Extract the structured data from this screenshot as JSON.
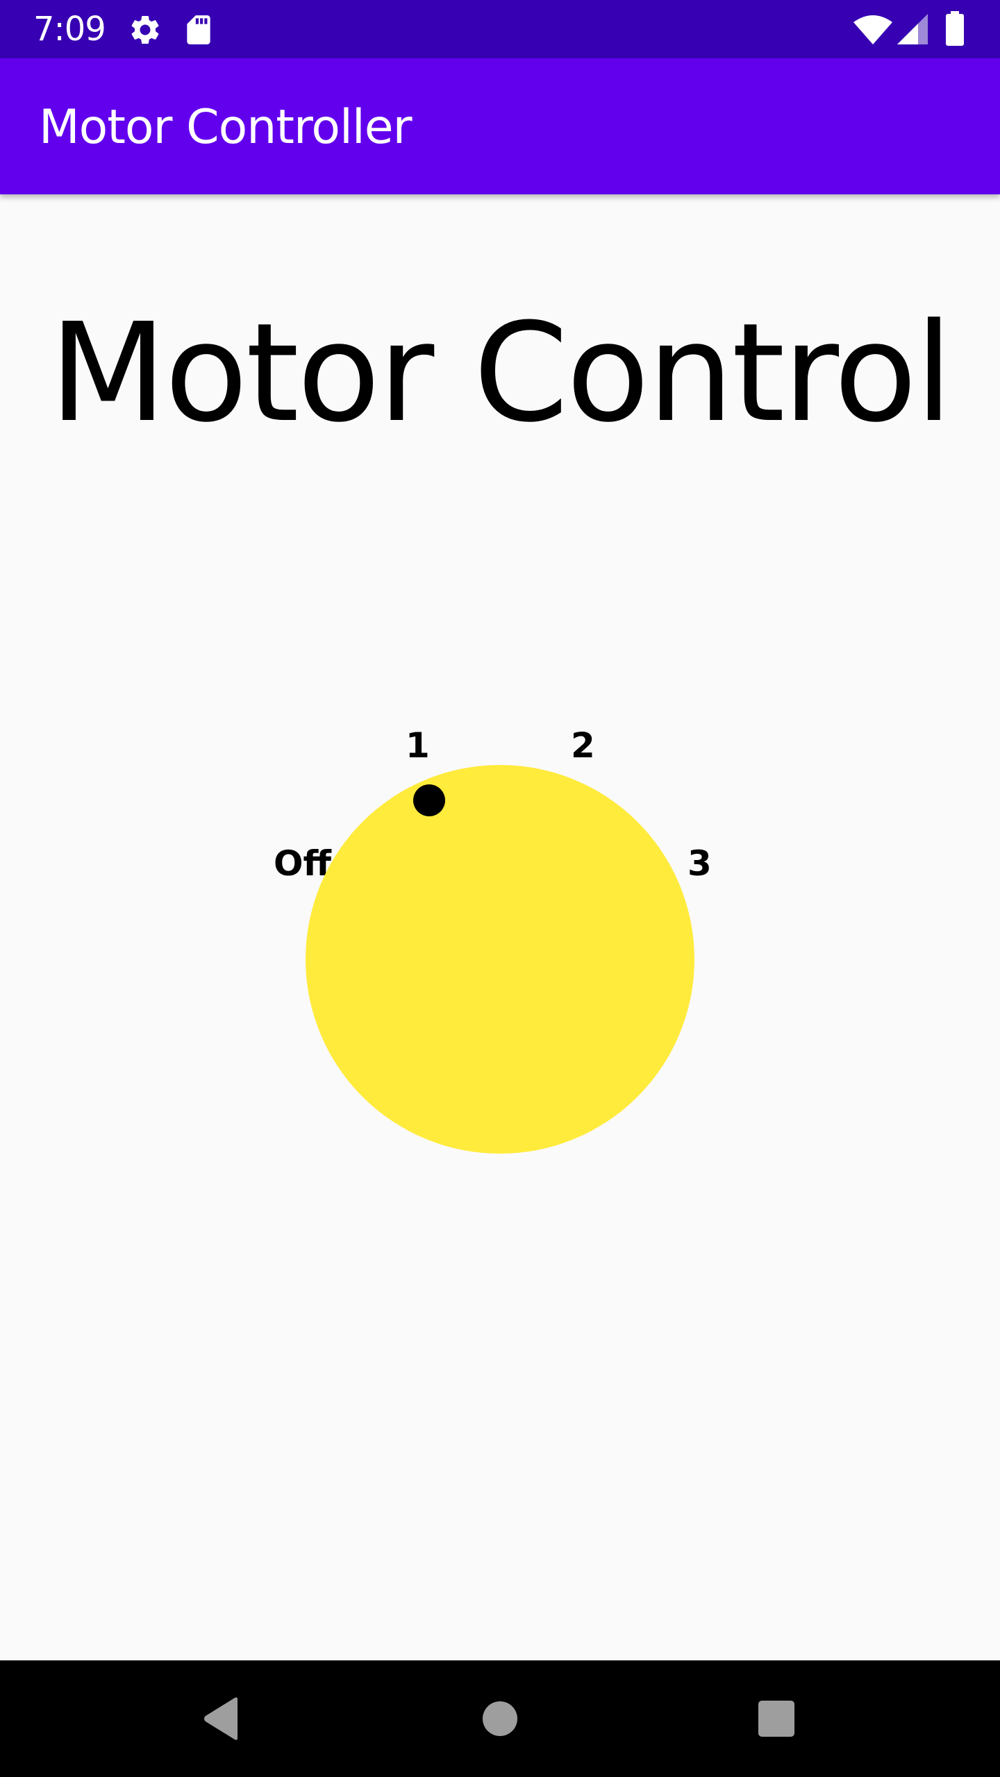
{
  "status_bar": {
    "time": "7:09",
    "icons": [
      "gear-icon",
      "sd-card-icon",
      "wifi-icon",
      "cell-signal-icon",
      "battery-icon"
    ],
    "background": "#3700b3"
  },
  "app_bar": {
    "title": "Motor Controller",
    "background": "#6200ee"
  },
  "main": {
    "heading": "Motor Control",
    "dial": {
      "color": "#ffeb3b",
      "selected": "1",
      "labels": {
        "off": "Off",
        "one": "1",
        "two": "2",
        "three": "3"
      }
    }
  },
  "nav_bar": {
    "buttons": [
      "back-icon",
      "home-icon",
      "recents-icon"
    ]
  }
}
